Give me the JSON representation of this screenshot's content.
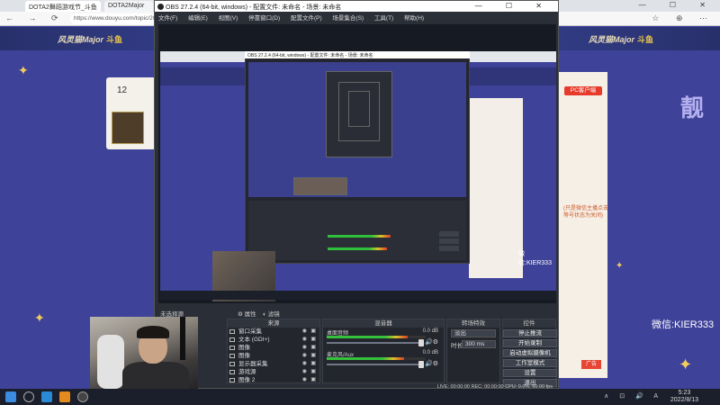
{
  "browser": {
    "tabs": [
      "DOTA2舞蹈游戏节_斗鱼",
      "DOTA2Major"
    ],
    "url": "https://www.douyu.com/topic/2022",
    "banner_logo": "风灵猫Major",
    "banner_logo_accent": "斗鱼",
    "card_number": "12",
    "pc_button": "PC客户端",
    "side_text_1": "(只是微信主播点击",
    "side_text_2": "等号状态为关闭)",
    "ad_button": "广告",
    "watermark": "微信:KIER333",
    "deco_text": "靓"
  },
  "taskbar": {
    "time": "5:23",
    "date": "2022/8/13",
    "tray": "∧ ⊡ 🔊 A"
  },
  "obs": {
    "title": "OBS 27.2.4 (64-bit, windows) - 配置文件: 未命名 - 场景: 未命名",
    "menu": [
      "文件(F)",
      "编辑(E)",
      "视图(V)",
      "停靠窗口(D)",
      "配置文件(P)",
      "场景集合(S)",
      "工具(T)",
      "帮助(H)"
    ],
    "inner_title": "OBS 27.2.4 (64-bit, windows) - 配置文件: 未命名 - 场景: 未命名",
    "inner_watermark": "微信:KIER333",
    "no_source": "未选择源",
    "properties_btn": "⚙ 属性",
    "filters_btn": "◐ 滤镜",
    "sources_header": "来源",
    "sources": [
      "窗口采集",
      "文本 (GDI+)",
      "图像",
      "图像",
      "显示器采集",
      "游戏源",
      "图像 2"
    ],
    "mixer_header": "混音器",
    "mixer": [
      {
        "name": "桌面音频",
        "db": "0.0 dB"
      },
      {
        "name": "麦克风/Aux",
        "db": "0.0 dB"
      }
    ],
    "transitions_header": "转场特效",
    "transition": {
      "label": "淡出",
      "duration_label": "时长",
      "duration": "300 ms"
    },
    "controls_header": "控件",
    "controls": [
      "停止推流",
      "开始录制",
      "启动虚拟摄像机",
      "工作室模式",
      "设置",
      "退出"
    ],
    "status": "LIVE: 00:00:00    REC: 00:00:00    CPU: 0.0%, 60.00 fps"
  },
  "colors": {
    "obs_bg": "#2a2e36",
    "page_bg": "#3f4299",
    "accent_red": "#e63a2a"
  },
  "meter_levels": [
    0.82,
    0.78
  ]
}
